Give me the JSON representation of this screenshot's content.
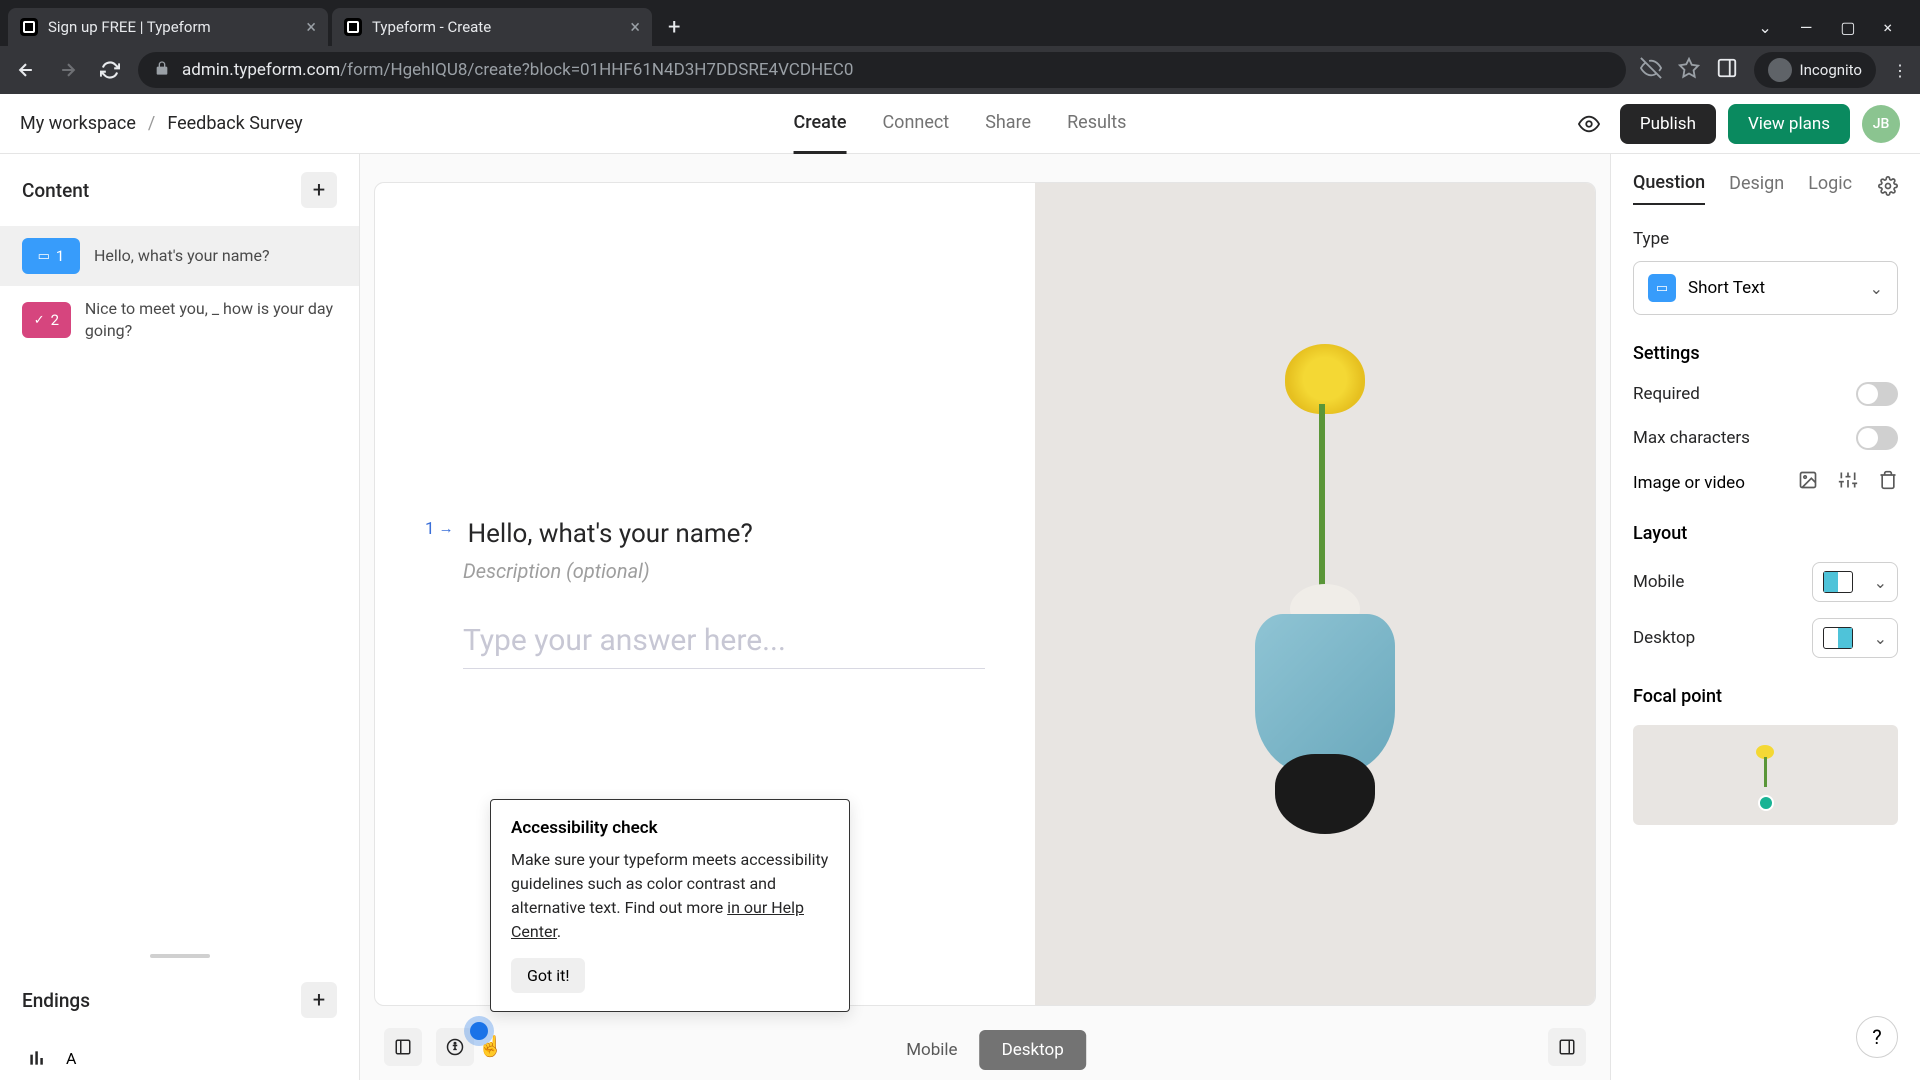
{
  "browser": {
    "tabs": [
      {
        "title": "Sign up FREE | Typeform"
      },
      {
        "title": "Typeform - Create"
      }
    ],
    "url_host": "admin.typeform.com",
    "url_path": "/form/HgehIQU8/create?block=01HHF61N4D3H7DDSRE4VCDHEC0",
    "incognito_label": "Incognito"
  },
  "header": {
    "workspace": "My workspace",
    "sep": "/",
    "form_name": "Feedback Survey",
    "nav": {
      "create": "Create",
      "connect": "Connect",
      "share": "Share",
      "results": "Results"
    },
    "publish": "Publish",
    "view_plans": "View plans",
    "avatar": "JB"
  },
  "sidebar": {
    "content_title": "Content",
    "items": [
      {
        "num": "1",
        "text": "Hello, what's your name?"
      },
      {
        "num": "2",
        "text": "Nice to meet you, _ how is your day going?"
      }
    ],
    "endings_title": "Endings",
    "ending_label": "A"
  },
  "canvas": {
    "q_num": "1",
    "q_arrow": "→",
    "q_title": "Hello, what's your name?",
    "q_desc": "Description (optional)",
    "answer_placeholder": "Type your answer here...",
    "view_mobile": "Mobile",
    "view_desktop": "Desktop"
  },
  "tooltip": {
    "title": "Accessibility check",
    "body_a": "Make sure your typeform meets accessibility guidelines such as color contrast and alternative text. Find out more ",
    "link": "in our Help Center",
    "body_b": ".",
    "button": "Got it!"
  },
  "right": {
    "tabs": {
      "question": "Question",
      "design": "Design",
      "logic": "Logic"
    },
    "type_label": "Type",
    "type_value": "Short Text",
    "settings_title": "Settings",
    "required": "Required",
    "max_chars": "Max characters",
    "image_video": "Image or video",
    "layout_title": "Layout",
    "mobile": "Mobile",
    "desktop": "Desktop",
    "focal_title": "Focal point"
  },
  "help": "?"
}
